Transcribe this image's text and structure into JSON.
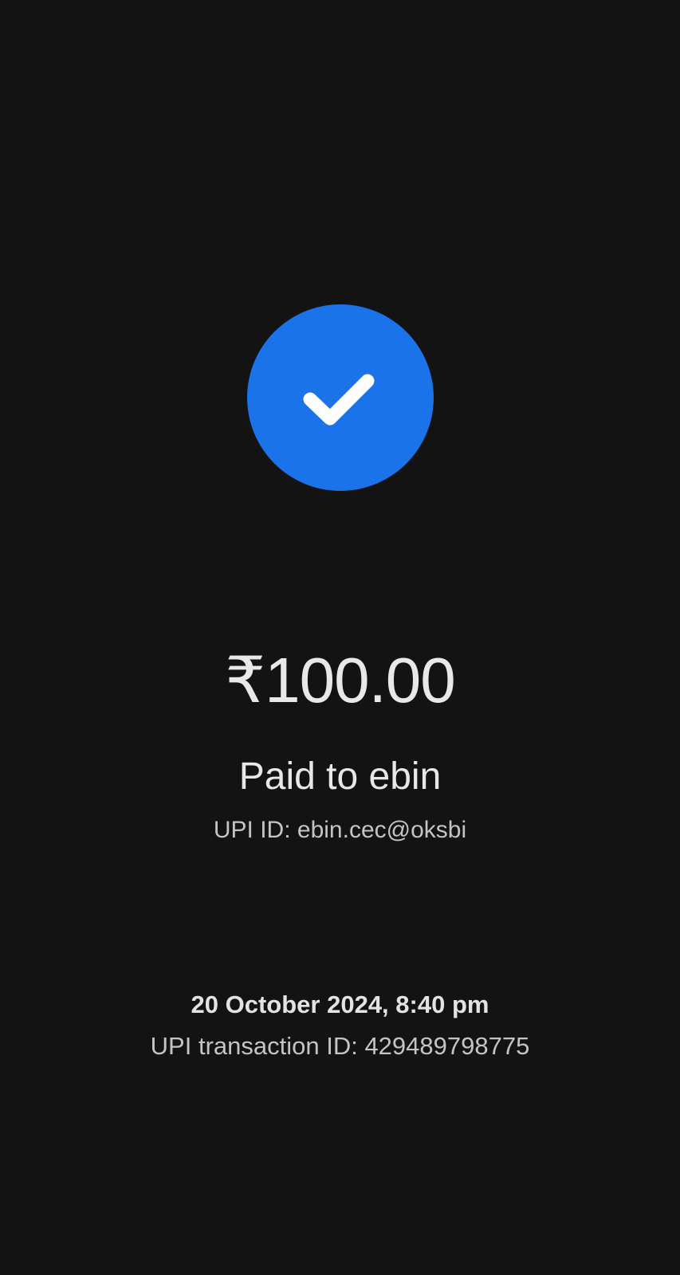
{
  "status": {
    "icon": "check-icon",
    "accent_color": "#1a73e8"
  },
  "payment": {
    "amount": "₹100.00",
    "paid_to": "Paid to ebin",
    "upi_id": "UPI ID: ebin.cec@oksbi"
  },
  "transaction": {
    "datetime": "20 October 2024, 8:40 pm",
    "id": "UPI transaction ID: 429489798775"
  }
}
